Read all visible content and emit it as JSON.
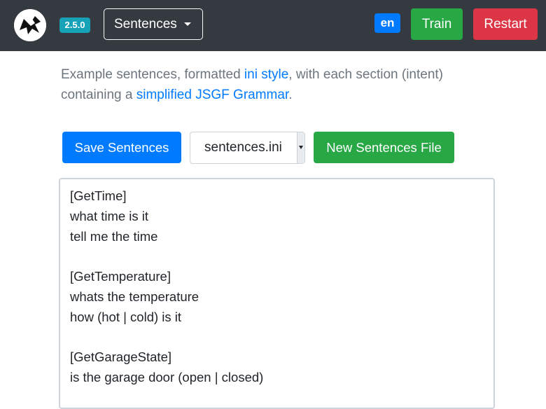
{
  "navbar": {
    "version": "2.5.0",
    "page_menu_label": "Sentences",
    "language": "en",
    "train_label": "Train",
    "restart_label": "Restart",
    "logo_icon": "rhasspy-logo-icon"
  },
  "description": {
    "part1": "Example sentences, formatted ",
    "link1": "ini style",
    "part2": ", with each section (intent) containing a ",
    "link2": "simplified JSGF Grammar",
    "part3": "."
  },
  "toolbar": {
    "save_label": "Save Sentences",
    "file_selected": "sentences.ini",
    "new_file_label": "New Sentences File"
  },
  "editor": {
    "lines": [
      "[GetTime]",
      "what time is it",
      "tell me the time",
      "",
      "[GetTemperature]",
      "whats the temperature",
      "how (hot | cold) is it",
      "",
      "[GetGarageState]",
      "is the garage door (open | closed)"
    ]
  },
  "colors": {
    "navbar": "#343a40",
    "primary": "#007bff",
    "success": "#28a745",
    "danger": "#dc3545",
    "info": "#17a2b8",
    "muted": "#6c757d"
  }
}
